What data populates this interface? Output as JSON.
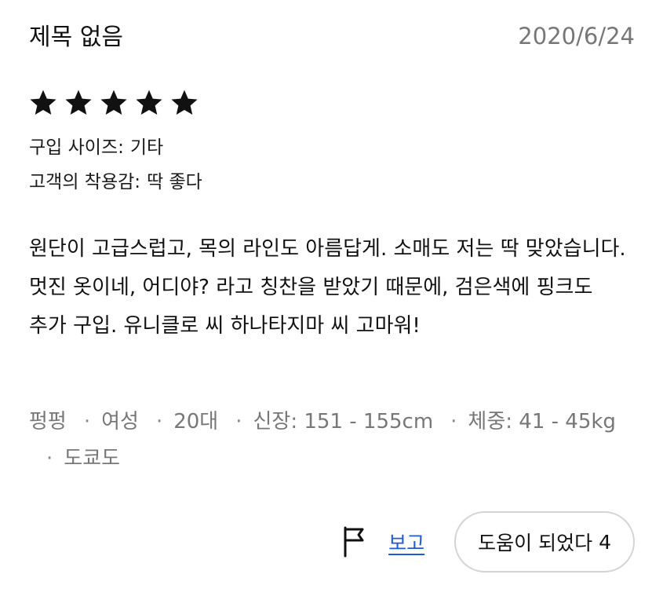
{
  "review": {
    "title": "제목 없음",
    "date": "2020/6/24",
    "rating": 5,
    "rating_max": 5,
    "purchase_size": {
      "label": "구입 사이즈:",
      "value": "기타"
    },
    "fit": {
      "label": "고객의 착용감:",
      "value": "딱 좋다"
    },
    "body": "원단이 고급스럽고, 목의 라인도 아름답게. 소매도 저는 딱 맞았습니다. 멋진 옷이네, 어디야? 라고 칭찬을 받았기 때문에, 검은색에 핑크도 추가 구입. 유니클로 씨 하나타지마 씨 고마워!",
    "reviewer": {
      "name": "펑펑",
      "gender": "여성",
      "age": "20대",
      "height": "신장: 151 - 155cm",
      "weight": "체중: 41 - 45kg",
      "region": "도쿄도"
    },
    "separator": "·",
    "actions": {
      "flag_icon": "flag-icon",
      "report_label": "보고",
      "helpful_label": "도움이 되었다",
      "helpful_count": "4"
    }
  },
  "colors": {
    "text": "#111111",
    "muted": "#777777",
    "link": "#1f5bd6",
    "border": "#d4d4d4"
  }
}
